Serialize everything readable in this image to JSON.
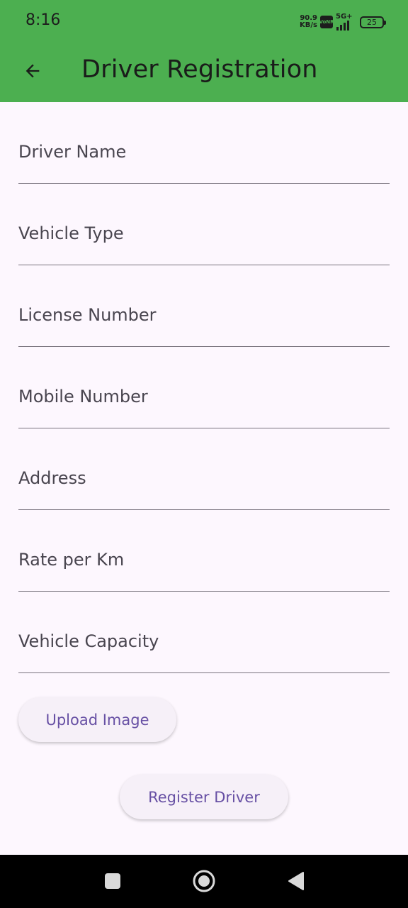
{
  "status_bar": {
    "time": "8:16",
    "net_speed_value": "90.9",
    "net_speed_unit": "KB/s",
    "volte_label_top": "Vo",
    "volte_label_bottom": "NR",
    "network_type": "5G+",
    "battery_level": "25"
  },
  "app_bar": {
    "title": "Driver Registration",
    "background_color": "#4caf50",
    "back_icon": "arrow-left-icon"
  },
  "form": {
    "fields": [
      {
        "label": "Driver Name",
        "value": ""
      },
      {
        "label": "Vehicle Type",
        "value": ""
      },
      {
        "label": "License Number",
        "value": ""
      },
      {
        "label": "Mobile Number",
        "value": ""
      },
      {
        "label": "Address",
        "value": ""
      },
      {
        "label": "Rate per Km",
        "value": ""
      },
      {
        "label": "Vehicle Capacity",
        "value": ""
      }
    ],
    "upload_button": "Upload Image",
    "register_button": "Register Driver",
    "accent_color": "#6750a4"
  },
  "nav_bar": {
    "recents_icon": "square-icon",
    "home_icon": "circle-icon",
    "back_icon": "triangle-back-icon"
  }
}
